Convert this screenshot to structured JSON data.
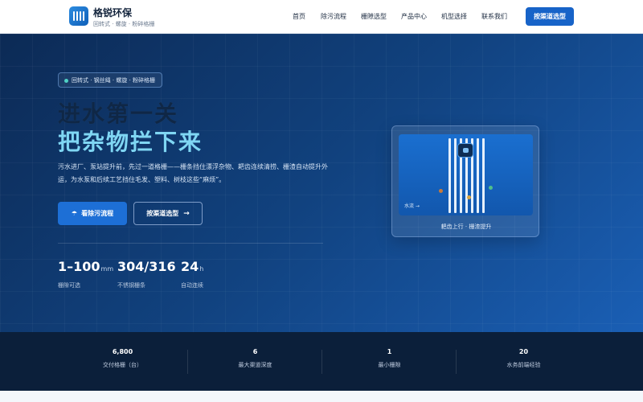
{
  "brand": {
    "name": "格锐环保",
    "tagline": "回转式 · 螺旋 · 粉碎格栅"
  },
  "nav": {
    "items": [
      "首页",
      "除污流程",
      "栅隙选型",
      "产品中心",
      "机型选择",
      "联系我们"
    ],
    "cta": "按渠道选型"
  },
  "hero": {
    "badge": "回转式 · 钢丝绳 · 螺旋 · 粉碎格栅",
    "title_line1": "进水第一关",
    "title_line2": "把杂物拦下来",
    "description": "污水进厂、泵站提升前，先过一道格栅——栅条挡住漂浮杂物、耙齿连续清捞、栅渣自动提升外运，为水泵和后续工艺挡住毛发、塑料、树枝这些“麻烦”。",
    "primary_button": "看除污流程",
    "secondary_button": "按渠道选型",
    "stats": [
      {
        "value": "1–100",
        "unit": "mm",
        "label": "栅隙可选"
      },
      {
        "value": "304/316",
        "unit": "",
        "label": "不锈钢栅条"
      },
      {
        "value": "24",
        "unit": "h",
        "label": "自动连续"
      }
    ]
  },
  "illustration": {
    "flow_label": "水流 →",
    "caption": "耙齿上行 · 栅渣提升"
  },
  "band": [
    {
      "value": "6,800",
      "label": "交付格栅（台）"
    },
    {
      "value": "6",
      "label": "最大渠道深度"
    },
    {
      "value": "1",
      "label": "最小栅隙"
    },
    {
      "value": "20",
      "label": "水务前端经验"
    }
  ],
  "colors": {
    "accent": "#1763c8",
    "title_highlight": "#7fd6f3",
    "band_bg": "#0b1f3a"
  },
  "icons": {
    "logo": "grille-logo-icon",
    "primary_button": "umbrella-icon",
    "secondary_button": "arrow-right-icon"
  }
}
